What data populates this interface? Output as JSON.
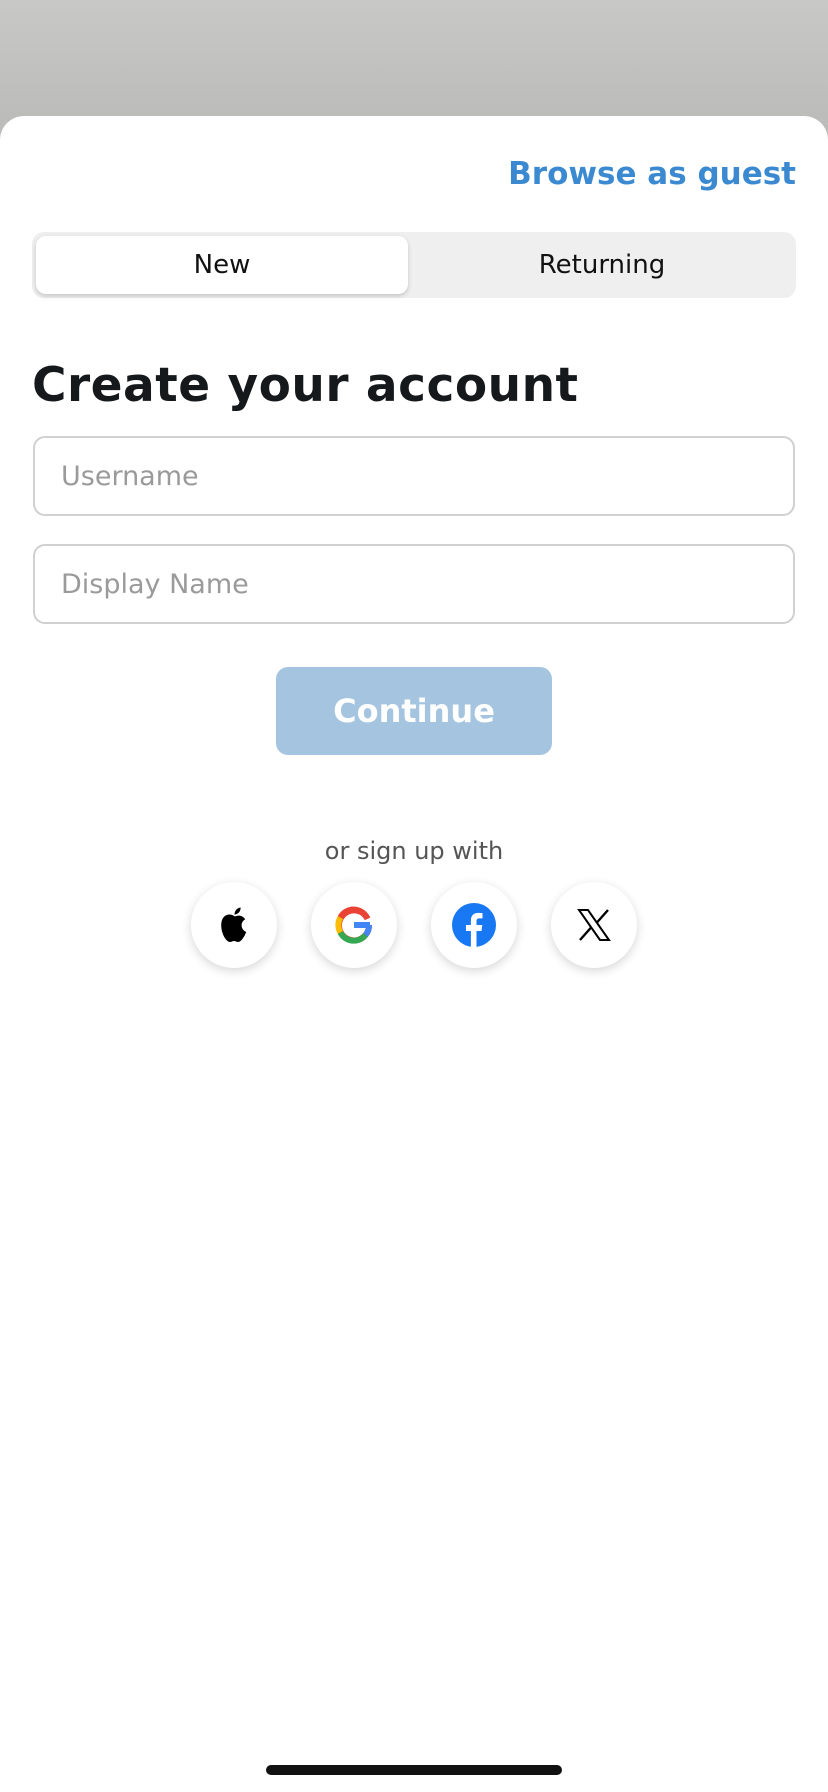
{
  "header": {
    "guest_link": "Browse as guest"
  },
  "tabs": {
    "items": [
      {
        "label": "New",
        "active": true
      },
      {
        "label": "Returning",
        "active": false
      }
    ]
  },
  "form": {
    "title": "Create your account",
    "username": {
      "placeholder": "Username",
      "value": ""
    },
    "display_name": {
      "placeholder": "Display Name",
      "value": ""
    },
    "continue_label": "Continue",
    "continue_enabled": false
  },
  "social": {
    "prompt": "or sign up with",
    "providers": [
      {
        "name": "apple-icon"
      },
      {
        "name": "google-icon"
      },
      {
        "name": "facebook-icon"
      },
      {
        "name": "x-icon"
      }
    ]
  },
  "colors": {
    "accent": "#3b8ad1",
    "continue_disabled": "#a4c4e0",
    "title": "#15191c",
    "segment_bg": "#efefef",
    "backdrop": "#c4c4c2"
  }
}
